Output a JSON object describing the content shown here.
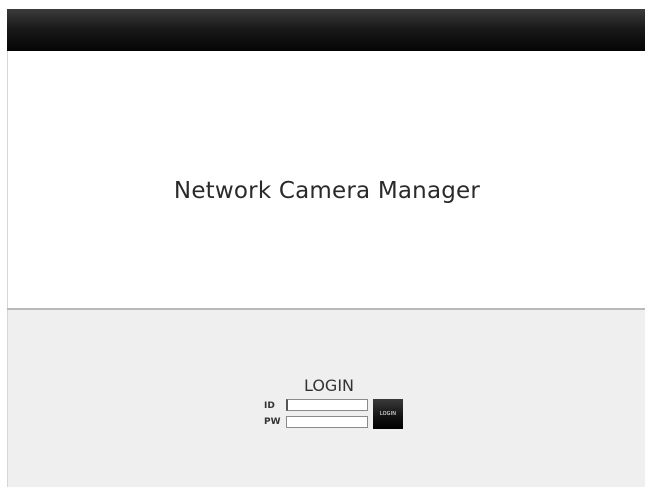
{
  "app": {
    "title": "Network Camera Manager"
  },
  "login": {
    "heading": "LOGIN",
    "id_label": "ID",
    "pw_label": "PW",
    "id_value": "",
    "pw_value": "",
    "button_label": "LOGIN"
  },
  "colors": {
    "top_bar": "#0a0a0a",
    "hero_background": "#ffffff",
    "login_background": "#efefef",
    "button_background": "#111111",
    "button_text": "#ffffff"
  }
}
